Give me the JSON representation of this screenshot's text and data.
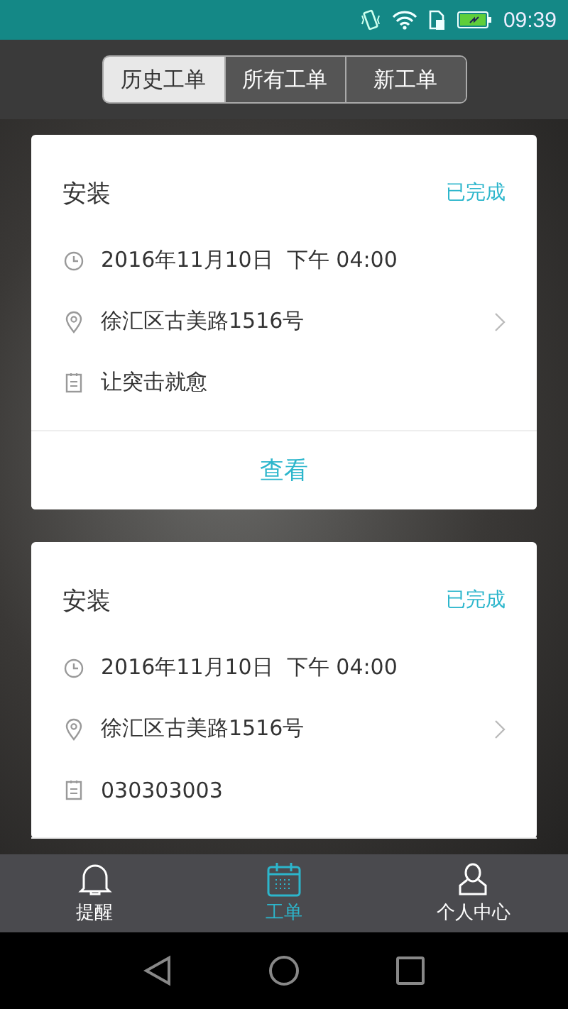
{
  "status_bar": {
    "time": "09:39"
  },
  "segments": [
    {
      "label": "历史工单",
      "selected": true
    },
    {
      "label": "所有工单",
      "selected": false
    },
    {
      "label": "新工单",
      "selected": false
    }
  ],
  "orders": [
    {
      "type": "安装",
      "status": "已完成",
      "datetime": "2016年11月10日  下午 04:00",
      "address": "徐汇区古美路1516号",
      "note": "让突击就愈",
      "action": "查看"
    },
    {
      "type": "安装",
      "status": "已完成",
      "datetime": "2016年11月10日  下午 04:00",
      "address": "徐汇区古美路1516号",
      "note": "030303003"
    }
  ],
  "tab_bar": [
    {
      "label": "提醒",
      "kind": "bell",
      "selected": false
    },
    {
      "label": "工单",
      "kind": "calendar",
      "selected": true
    },
    {
      "label": "个人中心",
      "kind": "person",
      "selected": false
    }
  ]
}
